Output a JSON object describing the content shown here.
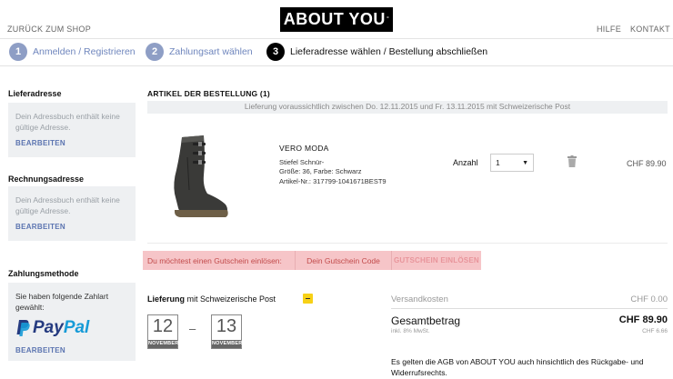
{
  "header": {
    "back_link": "ZURÜCK ZUM SHOP",
    "logo_text": "ABOUT YOU",
    "logo_mark": "°",
    "help": "HILFE",
    "contact": "KONTAKT"
  },
  "steps": [
    {
      "num": "1",
      "label": "Anmelden / Registrieren"
    },
    {
      "num": "2",
      "label": "Zahlungsart wählen"
    },
    {
      "num": "3",
      "label": "Lieferadresse wählen / Bestellung abschließen"
    }
  ],
  "sidebar": {
    "delivery": {
      "title": "Lieferadresse",
      "text": "Dein Adressbuch enthält keine gültige Adresse.",
      "link": "BEARBEITEN"
    },
    "billing": {
      "title": "Rechnungsadresse",
      "text": "Dein Adressbuch enthält keine gültige Adresse.",
      "link": "BEARBEITEN"
    },
    "payment": {
      "title": "Zahlungsmethode",
      "text": "Sie haben folgende Zahlart gewählt:",
      "brand_a": "Pay",
      "brand_b": "Pal",
      "link": "BEARBEITEN"
    }
  },
  "order": {
    "title": "ARTIKEL DER BESTELLUNG (1)",
    "delivery_note": "Lieferung voraussichtlich zwischen Do. 12.11.2015 und Fr. 13.11.2015 mit Schweizerische Post",
    "product": {
      "brand": "VERO MODA",
      "line1": "Stiefel Schnür-",
      "line2": "Größe: 36, Farbe: Schwarz",
      "line3": "Artikel-Nr.: 317799-1041671BEST9",
      "qty_label": "Anzahl",
      "qty_value": "1",
      "price": "CHF 89.90"
    }
  },
  "coupon": {
    "prompt": "Du möchtest einen Gutschein einlösen:",
    "placeholder": "Dein Gutschein Code",
    "button": "GUTSCHEIN EINLÖSEN"
  },
  "shipping": {
    "label_bold": "Lieferung",
    "label_rest": " mit Schweizerische Post",
    "from_day": "12",
    "from_month": "NOVEMBER",
    "to_day": "13",
    "to_month": "NOVEMBER",
    "dash": "–"
  },
  "summary": {
    "shipping_label": "Versandkosten",
    "shipping_value": "CHF 0.00",
    "total_label": "Gesamtbetrag",
    "total_value": "CHF 89.90",
    "vat_label": "inkl. 8% MwSt.",
    "vat_value": "CHF 6.66",
    "agb": "Es gelten die AGB von ABOUT YOU auch hinsichtlich des Rückgabe- und Widerrufsrechts."
  },
  "colors": {
    "accent": "#5b74b0",
    "coupon_bg": "#f6c5c8",
    "paypal_dark": "#253b80",
    "paypal_light": "#179bd7"
  }
}
